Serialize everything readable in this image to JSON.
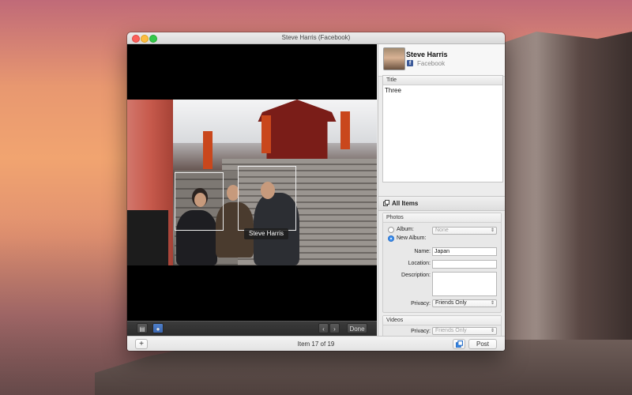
{
  "window": {
    "title": "Steve Harris (Facebook)"
  },
  "account": {
    "name": "Steve Harris",
    "service": "Facebook",
    "service_icon": "facebook-icon"
  },
  "preview": {
    "face_tag": "Steve Harris"
  },
  "preview_toolbar": {
    "done_label": "Done"
  },
  "status": {
    "item_text": "Item 17 of 19",
    "post_label": "Post",
    "add_label": "+"
  },
  "title_panel": {
    "header": "Title",
    "value": "Three"
  },
  "all_items": {
    "label": "All Items"
  },
  "photos": {
    "header": "Photos",
    "album_label": "Album:",
    "album_value": "None",
    "new_album_label": "New Album:",
    "name_label": "Name:",
    "name_value": "Japan",
    "location_label": "Location:",
    "location_value": "",
    "description_label": "Description:",
    "description_value": "",
    "privacy_label": "Privacy:",
    "privacy_value": "Friends Only"
  },
  "videos": {
    "header": "Videos",
    "privacy_label": "Privacy:",
    "privacy_value": "Friends Only"
  },
  "colors": {
    "facebook_blue": "#3b5998",
    "radio_selected": "#3d8fee",
    "close": "#fc605b",
    "minimize": "#fdbc40",
    "maximize": "#34c84a"
  }
}
